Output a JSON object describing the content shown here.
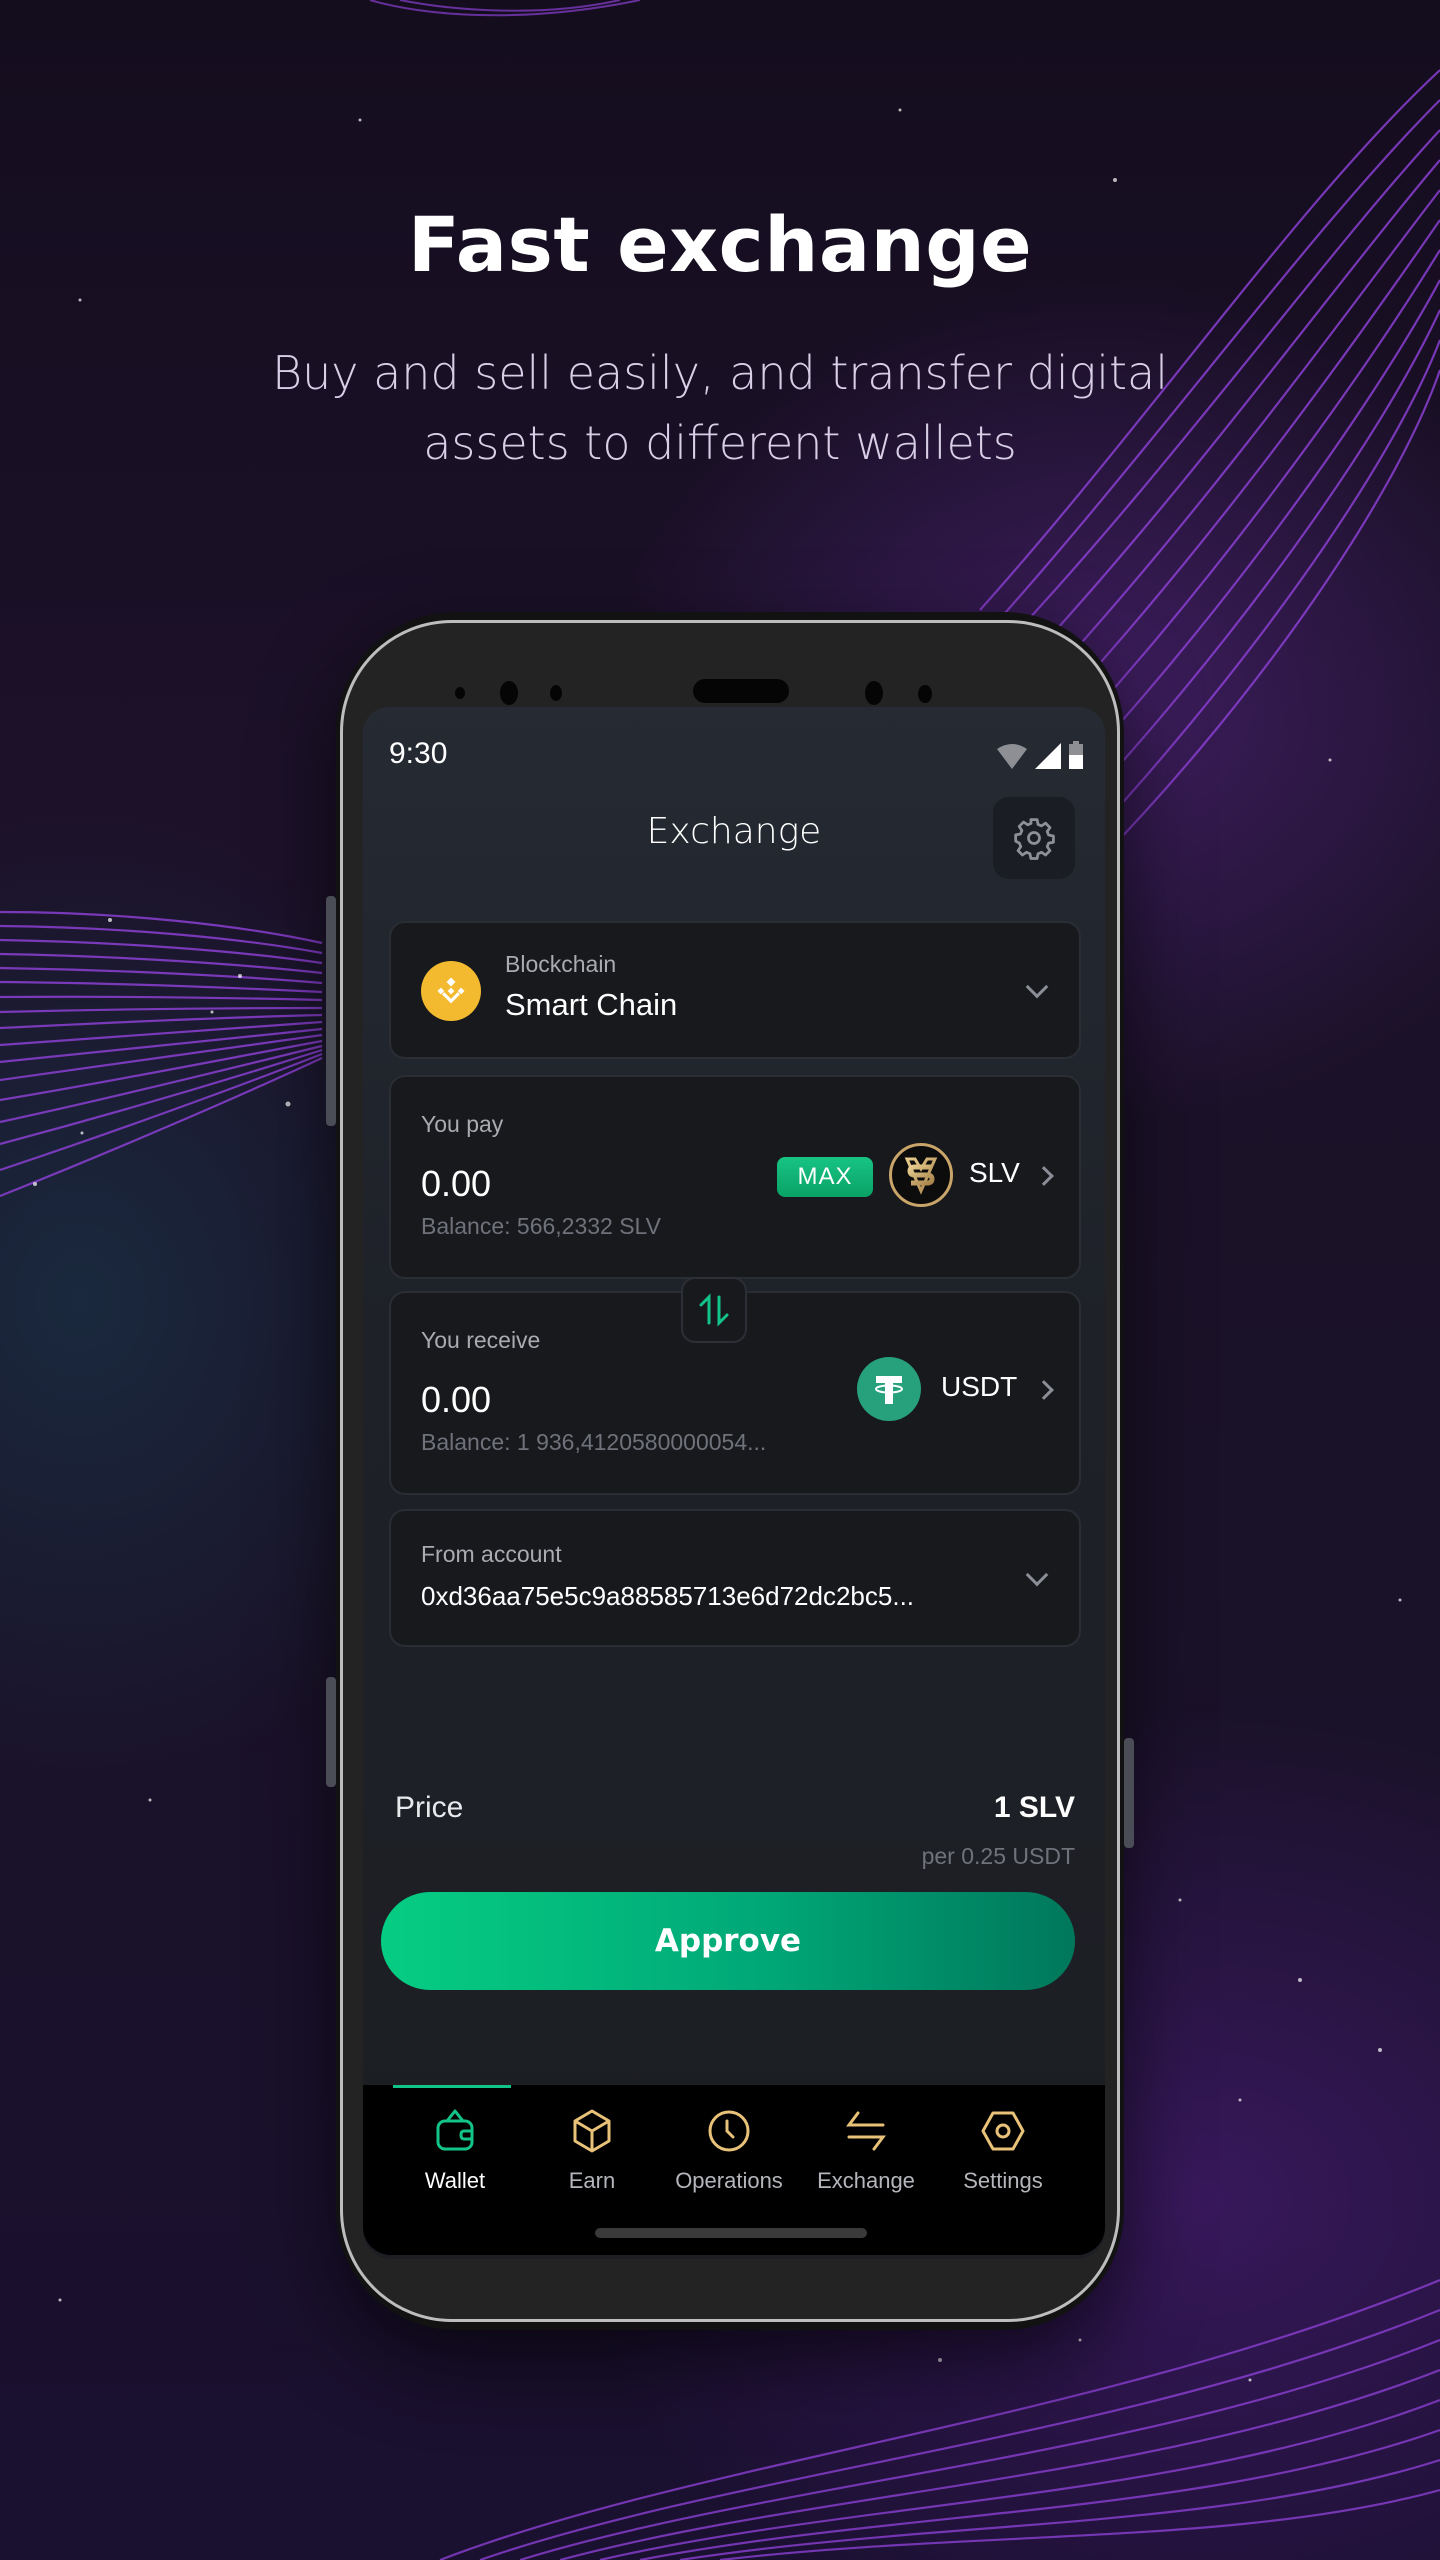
{
  "hero": {
    "title": "Fast exchange",
    "subtitle": "Buy and sell easily, and transfer digital assets to different wallets"
  },
  "status_bar": {
    "time": "9:30",
    "icons": [
      "wifi-icon",
      "signal-icon",
      "battery-icon"
    ]
  },
  "header": {
    "title": "Exchange",
    "settings_icon": "gear-icon"
  },
  "blockchain": {
    "label": "Blockchain",
    "value": "Smart Chain",
    "icon": "bnb-icon",
    "icon_color": "#f3ba2f"
  },
  "pay": {
    "label": "You pay",
    "amount": "0.00",
    "balance": "Balance: 566,2332 SLV",
    "max_label": "MAX",
    "token": "SLV",
    "token_icon": "slv-token-icon"
  },
  "receive": {
    "label": "You receive",
    "amount": "0.00",
    "balance": "Balance: 1 936,4120580000054...",
    "token": "USDT",
    "token_icon": "tether-icon",
    "token_color": "#26a17b"
  },
  "from_account": {
    "label": "From account",
    "value": "0xd36aa75e5c9a88585713e6d72dc2bc5..."
  },
  "price": {
    "label": "Price",
    "value": "1 SLV",
    "sub": "per 0.25 USDT"
  },
  "approve_label": "Approve",
  "nav": {
    "items": [
      {
        "label": "Wallet",
        "icon": "wallet-icon",
        "active": true
      },
      {
        "label": "Earn",
        "icon": "cube-icon",
        "active": false
      },
      {
        "label": "Operations",
        "icon": "clock-icon",
        "active": false
      },
      {
        "label": "Exchange",
        "icon": "exchange-arrows-icon",
        "active": false
      },
      {
        "label": "Settings",
        "icon": "hex-settings-icon",
        "active": false
      }
    ]
  },
  "colors": {
    "accent_green": "#12c487",
    "nav_icon_gold": "#e8c278"
  }
}
